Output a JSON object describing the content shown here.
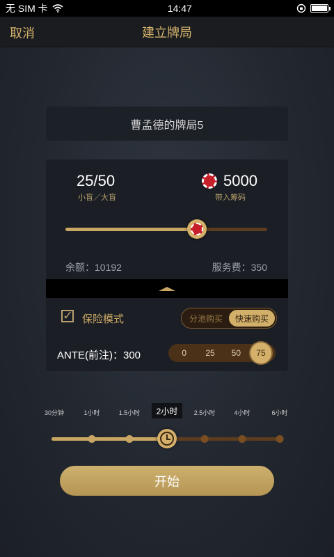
{
  "status_bar": {
    "carrier": "无 SIM 卡",
    "time": "14:47"
  },
  "nav": {
    "cancel_label": "取消",
    "title": "建立牌局"
  },
  "game_name": "曹孟德的牌局5",
  "blinds": {
    "value": "25/50",
    "label": "小盲／大盲"
  },
  "buyin": {
    "value": "5000",
    "label": "带入筹码",
    "slider_fraction": 0.65
  },
  "balance": "余额：10192",
  "service_fee": "服务费：350",
  "insurance": {
    "label": "保险模式",
    "checked": true,
    "options": [
      "分池购买",
      "快速购买"
    ],
    "selected": "快速购买"
  },
  "ante": {
    "label": "ANTE(前注)：300",
    "options": [
      "0",
      "25",
      "50",
      "75"
    ],
    "selected": "75"
  },
  "duration": {
    "options": [
      "30分钟",
      "1小时",
      "1.5小时",
      "2小时",
      "2.5小时",
      "4小时",
      "6小时"
    ],
    "selected_index": 3,
    "selected_label": "2小时"
  },
  "start_label": "开始",
  "colors": {
    "gold": "#c9a664",
    "brown": "#5b3c1f",
    "chip_red": "#c8202a"
  }
}
